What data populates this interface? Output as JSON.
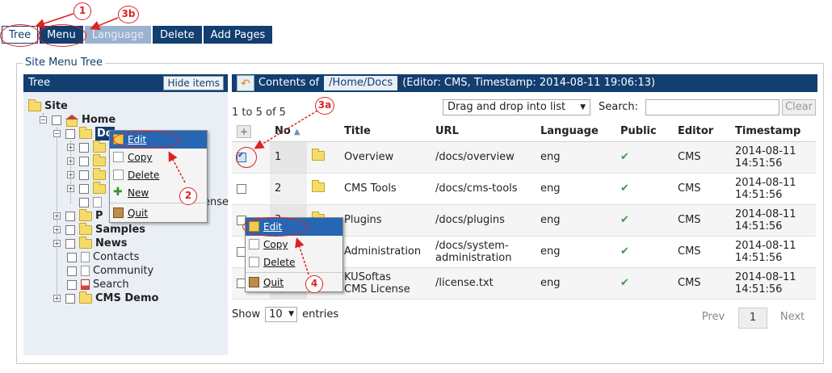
{
  "tabs": [
    {
      "label": "Tree",
      "state": "active"
    },
    {
      "label": "Menu",
      "state": "normal"
    },
    {
      "label": "Language",
      "state": "disabled"
    },
    {
      "label": "Delete",
      "state": "normal"
    },
    {
      "label": "Add Pages",
      "state": "normal"
    }
  ],
  "legend": "Site Menu Tree",
  "tree": {
    "title": "Tree",
    "hide_label": "Hide items",
    "root": "Site",
    "home": "Home",
    "docs": "Docs",
    "docs_partial": "Do",
    "license_partial": "ense",
    "p_partial": "P",
    "samples": "Samples",
    "news": "News",
    "contacts": "Contacts",
    "community": "Community",
    "search": "Search",
    "cms_demo": "CMS Demo"
  },
  "context_menu_tree": {
    "edit": "Edit",
    "copy": "Copy",
    "delete": "Delete",
    "new": "New",
    "quit": "Quit"
  },
  "context_menu_list": {
    "edit": "Edit",
    "copy": "Copy",
    "delete": "Delete",
    "quit": "Quit"
  },
  "contents": {
    "prefix": "Contents of",
    "path": "/Home/Docs",
    "suffix": "(Editor: CMS, Timestamp: 2014-08-11 19:06:13)"
  },
  "list": {
    "info": "1 to 5 of 5",
    "dropdown": "Drag and drop into list",
    "search_label": "Search:",
    "search_value": "",
    "clear": "Clear",
    "columns": [
      "No",
      "Title",
      "URL",
      "Language",
      "Public",
      "Editor",
      "Timestamp"
    ],
    "rows": [
      {
        "no": "1",
        "title": "Overview",
        "title2": "",
        "url": "/docs/overview",
        "url2": "",
        "lang": "eng",
        "editor": "CMS",
        "ts1": "2014-08-11",
        "ts2": "14:51:56",
        "checked": true
      },
      {
        "no": "2",
        "title": "CMS Tools",
        "title2": "",
        "url": "/docs/cms-tools",
        "url2": "",
        "lang": "eng",
        "editor": "CMS",
        "ts1": "2014-08-11",
        "ts2": "14:51:56",
        "checked": false
      },
      {
        "no": "3",
        "title": "Plugins",
        "title2": "",
        "url": "/docs/plugins",
        "url2": "",
        "lang": "eng",
        "editor": "CMS",
        "ts1": "2014-08-11",
        "ts2": "14:51:56",
        "checked": false
      },
      {
        "no": "4",
        "title": "Administration",
        "title2": "",
        "url": "/docs/system-",
        "url2": "administration",
        "lang": "eng",
        "editor": "CMS",
        "ts1": "2014-08-11",
        "ts2": "14:51:56",
        "checked": false
      },
      {
        "no": "5",
        "title": "KUSoftas",
        "title2": "CMS License",
        "url": "/license.txt",
        "url2": "",
        "lang": "eng",
        "editor": "CMS",
        "ts1": "2014-08-11",
        "ts2": "14:51:56",
        "checked": false
      }
    ],
    "show_label": "Show",
    "entries_value": "10",
    "entries_label": "entries",
    "prev": "Prev",
    "page": "1",
    "next": "Next"
  },
  "annotations": [
    "1",
    "3b",
    "2",
    "3a",
    "4"
  ],
  "colors": {
    "header": "#123e70",
    "annotation": "#dd2222",
    "highlight": "#2766b3"
  }
}
